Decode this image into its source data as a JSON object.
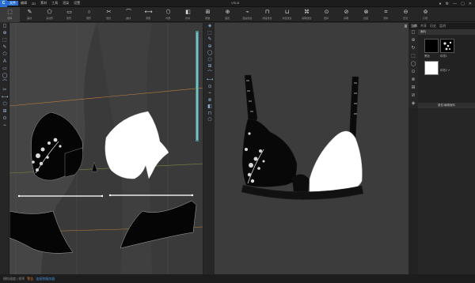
{
  "menubar": {
    "logo": "C",
    "items": [
      "文件",
      "编辑",
      "2D",
      "素材",
      "工具",
      "渲染",
      "设置"
    ],
    "active_index": 0,
    "title": "VSLB",
    "right_icons": [
      "●",
      "⚙",
      "—",
      "▢",
      "✕"
    ]
  },
  "toolbar": {
    "items": [
      {
        "icon": "⬚",
        "label": "选择"
      },
      {
        "icon": "✎",
        "label": "画线"
      },
      {
        "icon": "⬠",
        "label": "多边形"
      },
      {
        "icon": "▭",
        "label": "矩形"
      },
      {
        "icon": "○",
        "label": "圆形"
      },
      {
        "icon": "✂",
        "label": "缝合"
      },
      {
        "icon": "⌒",
        "label": "曲线"
      },
      {
        "icon": "⟷",
        "label": "测量"
      },
      {
        "icon": "⬡",
        "label": "内部"
      },
      {
        "icon": "◧",
        "label": "折叠"
      },
      {
        "icon": "⊞",
        "label": "褶皱"
      },
      {
        "icon": "⊕",
        "label": "固定"
      },
      {
        "icon": "⌁",
        "label": "自由缝合"
      },
      {
        "icon": "⊓",
        "label": "线段缝合"
      },
      {
        "icon": "⊔",
        "label": "对位缝合"
      },
      {
        "icon": "⌘",
        "label": "编辑缝合"
      },
      {
        "icon": "⊙",
        "label": "纽扣"
      },
      {
        "icon": "⊘",
        "label": "扣眼"
      },
      {
        "icon": "⊗",
        "label": "拉链"
      },
      {
        "icon": "⌗",
        "label": "安排"
      },
      {
        "icon": "⊖",
        "label": "压烫"
      },
      {
        "icon": "⊚",
        "label": "打褶"
      }
    ],
    "selected_index": 0
  },
  "left_tools": [
    "◻",
    "⊕",
    "⬚",
    "✎",
    "⬠",
    "A",
    "▭",
    "◯",
    "⌒",
    "✂",
    "⟷",
    "⬡",
    "⊞",
    "⊙",
    "⌁"
  ],
  "mid_tools": [
    "◈",
    "⬚",
    "✎",
    "⊕",
    "◯",
    "⬡",
    "⊞",
    "⌒",
    "⟷",
    "⊙",
    "⌁",
    "⊗",
    "◧",
    "⊓",
    "⬠"
  ],
  "right_panel": {
    "tabs": [
      "当前",
      "共享",
      "历史",
      "监测"
    ],
    "active_tab": 0,
    "side_icons": [
      "◻",
      "⊕",
      "↻",
      "⬚",
      "◯",
      "⊙",
      "⊗",
      "⊞",
      "⊘",
      "◈"
    ],
    "header": "面料",
    "fabrics": [
      {
        "label": "黑色",
        "color": "#000000",
        "lace": false
      },
      {
        "label": "印花1",
        "color": "#000000",
        "lace": true
      },
      {
        "label": "印花2 ↗",
        "color": "#ffffff",
        "lace": false
      }
    ],
    "sub_header": "属性/编辑面料"
  },
  "status": {
    "text": "模拟速度 | 帧率",
    "warn": "警告",
    "link": "连接到服务器"
  },
  "colors": {
    "accent": "#2a6fd6",
    "pattern_black": "#050505",
    "pattern_white": "#ffffff",
    "grid_orange": "#c2803a",
    "grid_green": "#7a8a3a"
  }
}
